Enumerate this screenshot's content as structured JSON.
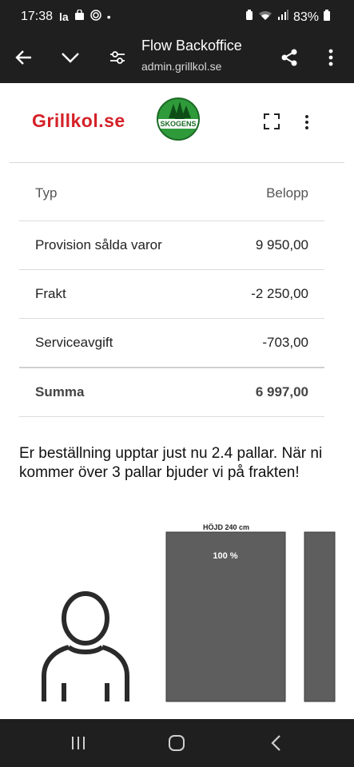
{
  "status_bar": {
    "time": "17:38",
    "left_icons": [
      "la-icon",
      "bag-icon",
      "target-icon",
      "dot-icon"
    ],
    "battery": "83%"
  },
  "app_bar": {
    "title": "Flow Backoffice",
    "url": "admin.grillkol.se"
  },
  "header": {
    "logo_text": "Grillkol.se",
    "partner_logo_text": "SKOGENS"
  },
  "table": {
    "headers": {
      "type": "Typ",
      "amount": "Belopp"
    },
    "rows": [
      {
        "type": "Provision sålda varor",
        "amount": "9 950,00"
      },
      {
        "type": "Frakt",
        "amount": "-2 250,00"
      },
      {
        "type": "Serviceavgift",
        "amount": "-703,00"
      }
    ],
    "total": {
      "type": "Summa",
      "amount": "6 997,00"
    }
  },
  "message": "Er beställning upptar just nu 2.4 pallar. När ni kommer över 3 pallar bjuder vi på frakten!",
  "pallet_graphic": {
    "height_label": "HÖJD 240 cm",
    "fill_label": "100 %",
    "fill_level": 1.0,
    "color": "#5e5e5e"
  },
  "colors": {
    "brand": "#d42127",
    "partner_green": "#2f9a3a",
    "bars": "#1f1f1f"
  }
}
